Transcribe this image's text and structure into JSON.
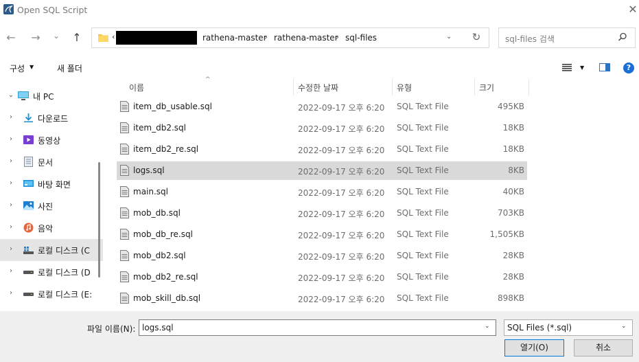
{
  "window": {
    "title": "Open SQL Script",
    "icon": "mysql-workbench-icon",
    "close": "✕"
  },
  "nav": {
    "back": "←",
    "forward": "→",
    "recent": "⌄",
    "up": "↑",
    "address": {
      "chevron": "‹",
      "crumbs": [
        "rathena-master",
        "rathena-master",
        "sql-files"
      ],
      "separator": "›"
    },
    "dropdown": "⌄",
    "refresh": "↻",
    "search_placeholder": "sql-files 검색"
  },
  "toolbar": {
    "organize": "구성",
    "new_folder": "새 폴더",
    "help": "?"
  },
  "sidebar": {
    "items": [
      {
        "label": "내 PC",
        "icon": "pc-icon",
        "chevron": "⌄",
        "selected": false
      },
      {
        "label": "다운로드",
        "icon": "download-icon",
        "chevron": "›",
        "selected": false
      },
      {
        "label": "동영상",
        "icon": "video-icon",
        "chevron": "›",
        "selected": false
      },
      {
        "label": "문서",
        "icon": "document-icon",
        "chevron": "›",
        "selected": false
      },
      {
        "label": "바탕 화면",
        "icon": "desktop-icon",
        "chevron": "›",
        "selected": false
      },
      {
        "label": "사진",
        "icon": "pictures-icon",
        "chevron": "›",
        "selected": false
      },
      {
        "label": "음악",
        "icon": "music-icon",
        "chevron": "›",
        "selected": false
      },
      {
        "label": "로컬 디스크 (C",
        "icon": "windows-drive-icon",
        "chevron": "›",
        "selected": true
      },
      {
        "label": "로컬 디스크 (D",
        "icon": "drive-icon",
        "chevron": "›",
        "selected": false
      },
      {
        "label": "로컬 디스크 (E:",
        "icon": "drive-icon",
        "chevron": "›",
        "selected": false
      }
    ]
  },
  "columns": {
    "name": "이름",
    "date": "수정한 날짜",
    "type": "유형",
    "size": "크기"
  },
  "files": [
    {
      "name": "item_db_usable.sql",
      "date": "2022-09-17 오후 6:20",
      "type": "SQL Text File",
      "size": "495KB"
    },
    {
      "name": "item_db2.sql",
      "date": "2022-09-17 오후 6:20",
      "type": "SQL Text File",
      "size": "18KB"
    },
    {
      "name": "item_db2_re.sql",
      "date": "2022-09-17 오후 6:20",
      "type": "SQL Text File",
      "size": "18KB"
    },
    {
      "name": "logs.sql",
      "date": "2022-09-17 오후 6:20",
      "type": "SQL Text File",
      "size": "8KB"
    },
    {
      "name": "main.sql",
      "date": "2022-09-17 오후 6:20",
      "type": "SQL Text File",
      "size": "40KB"
    },
    {
      "name": "mob_db.sql",
      "date": "2022-09-17 오후 6:20",
      "type": "SQL Text File",
      "size": "703KB"
    },
    {
      "name": "mob_db_re.sql",
      "date": "2022-09-17 오후 6:20",
      "type": "SQL Text File",
      "size": "1,505KB"
    },
    {
      "name": "mob_db2.sql",
      "date": "2022-09-17 오후 6:20",
      "type": "SQL Text File",
      "size": "28KB"
    },
    {
      "name": "mob_db2_re.sql",
      "date": "2022-09-17 오후 6:20",
      "type": "SQL Text File",
      "size": "28KB"
    },
    {
      "name": "mob_skill_db.sql",
      "date": "2022-09-17 오후 6:20",
      "type": "SQL Text File",
      "size": "898KB"
    }
  ],
  "selected_file_index": 3,
  "footer": {
    "filename_label": "파일 이름(N):",
    "filename_value": "logs.sql",
    "filetype_value": "SQL Files (*.sql)",
    "dropdown": "⌄",
    "open_label": "열기(O)",
    "cancel_label": "취소"
  },
  "colors": {
    "accent": "#0078d7",
    "help": "#1a6fd6",
    "selection": "#d9d9d9",
    "folder": "#f5c242"
  }
}
